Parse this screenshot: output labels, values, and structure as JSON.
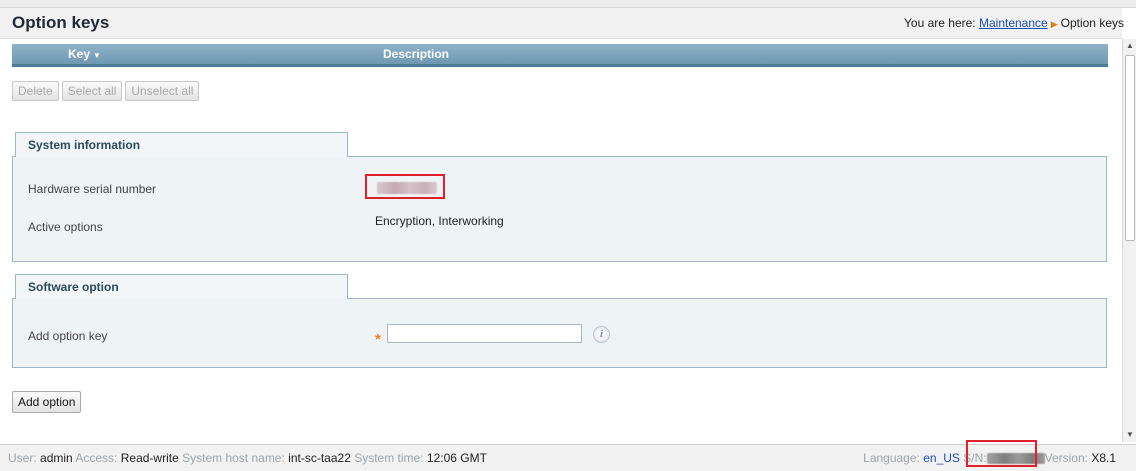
{
  "header": {
    "title": "Option keys",
    "breadcrumb_prefix": "You are here:",
    "breadcrumb_link": "Maintenance",
    "breadcrumb_current": "Option keys"
  },
  "keys_table": {
    "columns": [
      "Key",
      "Description"
    ]
  },
  "toolbar": {
    "delete_label": "Delete",
    "select_all_label": "Select all",
    "unselect_all_label": "Unselect all"
  },
  "system_information": {
    "title": "System information",
    "rows": [
      {
        "label": "Hardware serial number",
        "value": ""
      },
      {
        "label": "Active options",
        "value": "Encryption, Interworking"
      }
    ]
  },
  "software_option": {
    "title": "Software option",
    "field_label": "Add option key",
    "required_marker": "*",
    "field_value": "",
    "info_icon_glyph": "i"
  },
  "add_option_label": "Add option",
  "footer": {
    "user_label": "User:",
    "user": "admin",
    "access_label": "Access:",
    "access": "Read-write",
    "host_label": "System host name:",
    "host": "int-sc-taa22",
    "time_label": "System time:",
    "time": "12:06 GMT",
    "language_label": "Language:",
    "language": "en_US",
    "sn_label": "S/N:",
    "version_label": "Version:",
    "version": "X8.1"
  },
  "colors": {
    "header_bar": "#7aa2bb",
    "section_bg": "#eef3f6",
    "highlight_box": "#e0202a",
    "required": "#f07a1d",
    "link": "#1a4fb5"
  }
}
